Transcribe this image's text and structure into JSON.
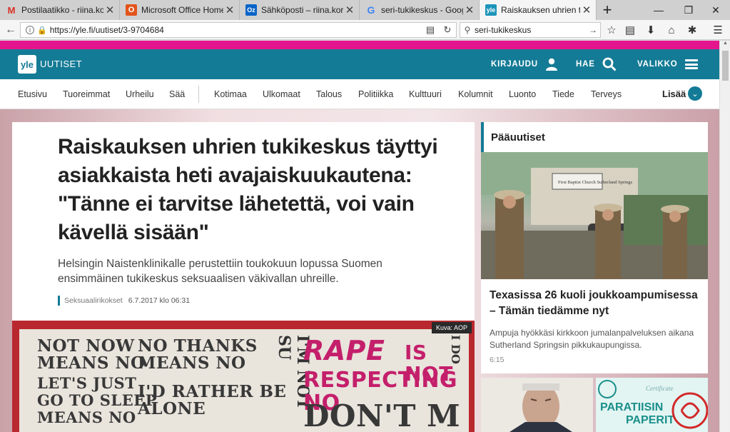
{
  "browser": {
    "tabs": [
      {
        "icon": "gmail-icon",
        "glyph": "M",
        "title": "Postilaatikko - riina.korjam"
      },
      {
        "icon": "office-icon",
        "glyph": "O",
        "title": "Microsoft Office Home"
      },
      {
        "icon": "outlook-icon",
        "glyph": "Oz",
        "title": "Sähköposti – riina.korjamo"
      },
      {
        "icon": "google-icon",
        "glyph": "G",
        "title": "seri-tukikeskus - Google-h"
      },
      {
        "icon": "yle-icon",
        "glyph": "yle",
        "title": "Raiskauksen uhrien tukike"
      }
    ],
    "url": "https://yle.fi/uutiset/3-9704684",
    "search_value": "seri-tukikeskus"
  },
  "site": {
    "logo": "yle",
    "section": "UUTISET",
    "actions": {
      "login": "KIRJAUDU",
      "search": "HAE",
      "menu": "VALIKKO"
    },
    "nav_primary": [
      "Etusivu",
      "Tuoreimmat",
      "Urheilu",
      "Sää"
    ],
    "nav_secondary": [
      "Kotimaa",
      "Ulkomaat",
      "Talous",
      "Politiikka",
      "Kulttuuri",
      "Kolumnit",
      "Luonto",
      "Tiede",
      "Terveys"
    ],
    "more": "Lisää"
  },
  "article": {
    "headline": "Raiskauksen uhrien tukikeskus täyttyi asiakkaista heti avajaiskuukautena: \"Tänne ei tarvitse lähetettä, voi vain kävellä sisään\"",
    "lead": "Helsingin Naistenklinikalle perustettiin toukokuun lopussa Suomen ensimmäinen tukikeskus seksuaalisen väkivallan uhreille.",
    "category": "Seksuaalirikokset",
    "date": "6.7.2017 klo 06:31",
    "image_caption": "Kuva: AOP",
    "sign_texts": {
      "s1": "NOT NOW MEANS NO",
      "s2": "LET'S JUST GO TO SLEEP MEANS NO",
      "s3": "NO THANKS MEANS NO",
      "s4": "I'D RATHER BE ALONE",
      "s5": "I'M NOT SU",
      "s6a": "RAPE",
      "s6b": "IS NOT",
      "s6c": "RESPECTING NO",
      "s7": "DON'T M",
      "s8": "I DO"
    }
  },
  "sidebar": {
    "heading": "Pääuutiset",
    "top_story": {
      "title": "Texasissa 26 kuoli joukkoampumisessa – Tämän tiedämme nyt",
      "description": "Ampuja hyökkäsi kirkkoon jumalanpalveluksen aikana Sutherland Springsin pikkukaupungissa.",
      "time": "6:15",
      "photo_sign": "First Baptist Church Sutherland Springs"
    },
    "thumb2_texts": {
      "a": "PARATIISIN",
      "b": "PAPERIT",
      "c": "Certificate"
    }
  },
  "colors": {
    "yle_teal": "#147b96",
    "pink_strip": "#e5168d",
    "hero_red": "#b9282f"
  }
}
